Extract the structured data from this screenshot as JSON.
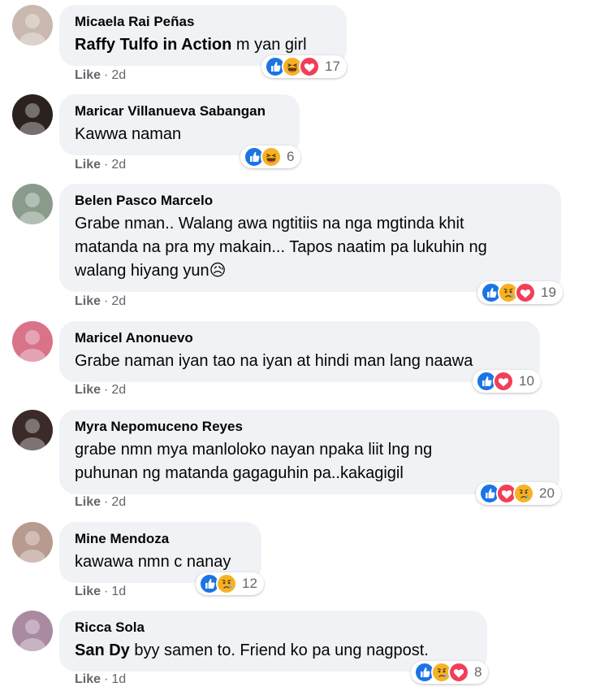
{
  "like_label": "Like",
  "dot": "·",
  "comments": [
    {
      "author": "Micaela Rai Peñas",
      "tag": "Raffy Tulfo in Action",
      "lines": [
        "m yan girl"
      ],
      "time": "2d",
      "reactions": [
        "like",
        "haha",
        "love"
      ],
      "count": "17",
      "avatar_color": "#c9b9b0"
    },
    {
      "author": "Maricar Villanueva Sabangan",
      "tag": "",
      "lines": [
        "Kawwa naman"
      ],
      "time": "2d",
      "reactions": [
        "like",
        "haha"
      ],
      "count": "6",
      "avatar_color": "#2b2220"
    },
    {
      "author": "Belen Pasco Marcelo",
      "tag": "",
      "lines": [
        "Grabe nman.. Walang awa ngtitiis na nga mgtinda khit",
        "matanda na pra my makain... Tapos naatim pa lukuhin ng",
        "walang hiyang yun😥"
      ],
      "time": "2d",
      "reactions": [
        "like",
        "sad",
        "love"
      ],
      "count": "19",
      "avatar_color": "#8a9b8c"
    },
    {
      "author": "Maricel Anonuevo",
      "tag": "",
      "lines": [
        "Grabe naman iyan tao na iyan at hindi man lang naawa"
      ],
      "time": "2d",
      "reactions": [
        "like",
        "love"
      ],
      "count": "10",
      "avatar_color": "#d8738a"
    },
    {
      "author": "Myra Nepomuceno Reyes",
      "tag": "",
      "lines": [
        "grabe nmn mya manloloko nayan npaka liit lng ng",
        "puhunan ng matanda gagaguhin pa..kakagigil"
      ],
      "time": "2d",
      "reactions": [
        "like",
        "love",
        "sad"
      ],
      "count": "20",
      "avatar_color": "#3a2a28"
    },
    {
      "author": "Mine Mendoza",
      "tag": "",
      "lines": [
        "kawawa nmn c nanay"
      ],
      "time": "1d",
      "reactions": [
        "like",
        "sad"
      ],
      "count": "12",
      "avatar_color": "#b89a8e"
    },
    {
      "author": "Ricca Sola",
      "tag": "San Dy",
      "lines": [
        "byy samen to. Friend ko pa ung nagpost."
      ],
      "time": "1d",
      "reactions": [
        "like",
        "sad",
        "love"
      ],
      "count": "8",
      "avatar_color": "#a98aa0"
    }
  ]
}
